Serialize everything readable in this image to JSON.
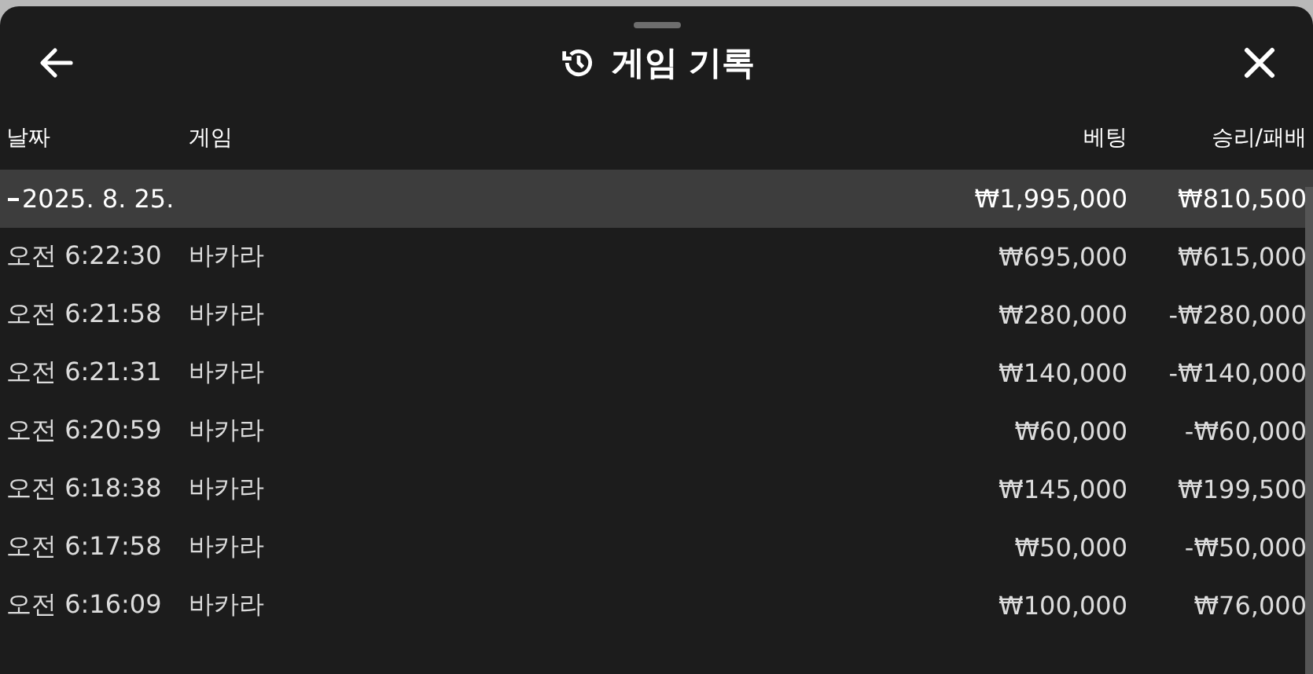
{
  "header": {
    "title": "게임 기록"
  },
  "columns": [
    "날짜",
    "게임",
    "베팅",
    "승리/패배"
  ],
  "group": {
    "date": "2025. 8. 25.",
    "expanded": true,
    "bet": "₩1,995,000",
    "result": "₩810,500"
  },
  "rows": [
    {
      "time": "오전 6:22:30",
      "game": "바카라",
      "bet": "₩695,000",
      "result": "₩615,000"
    },
    {
      "time": "오전 6:21:58",
      "game": "바카라",
      "bet": "₩280,000",
      "result": "-₩280,000"
    },
    {
      "time": "오전 6:21:31",
      "game": "바카라",
      "bet": "₩140,000",
      "result": "-₩140,000"
    },
    {
      "time": "오전 6:20:59",
      "game": "바카라",
      "bet": "₩60,000",
      "result": "-₩60,000"
    },
    {
      "time": "오전 6:18:38",
      "game": "바카라",
      "bet": "₩145,000",
      "result": "₩199,500"
    },
    {
      "time": "오전 6:17:58",
      "game": "바카라",
      "bet": "₩50,000",
      "result": "-₩50,000"
    },
    {
      "time": "오전 6:16:09",
      "game": "바카라",
      "bet": "₩100,000",
      "result": "₩76,000"
    }
  ]
}
